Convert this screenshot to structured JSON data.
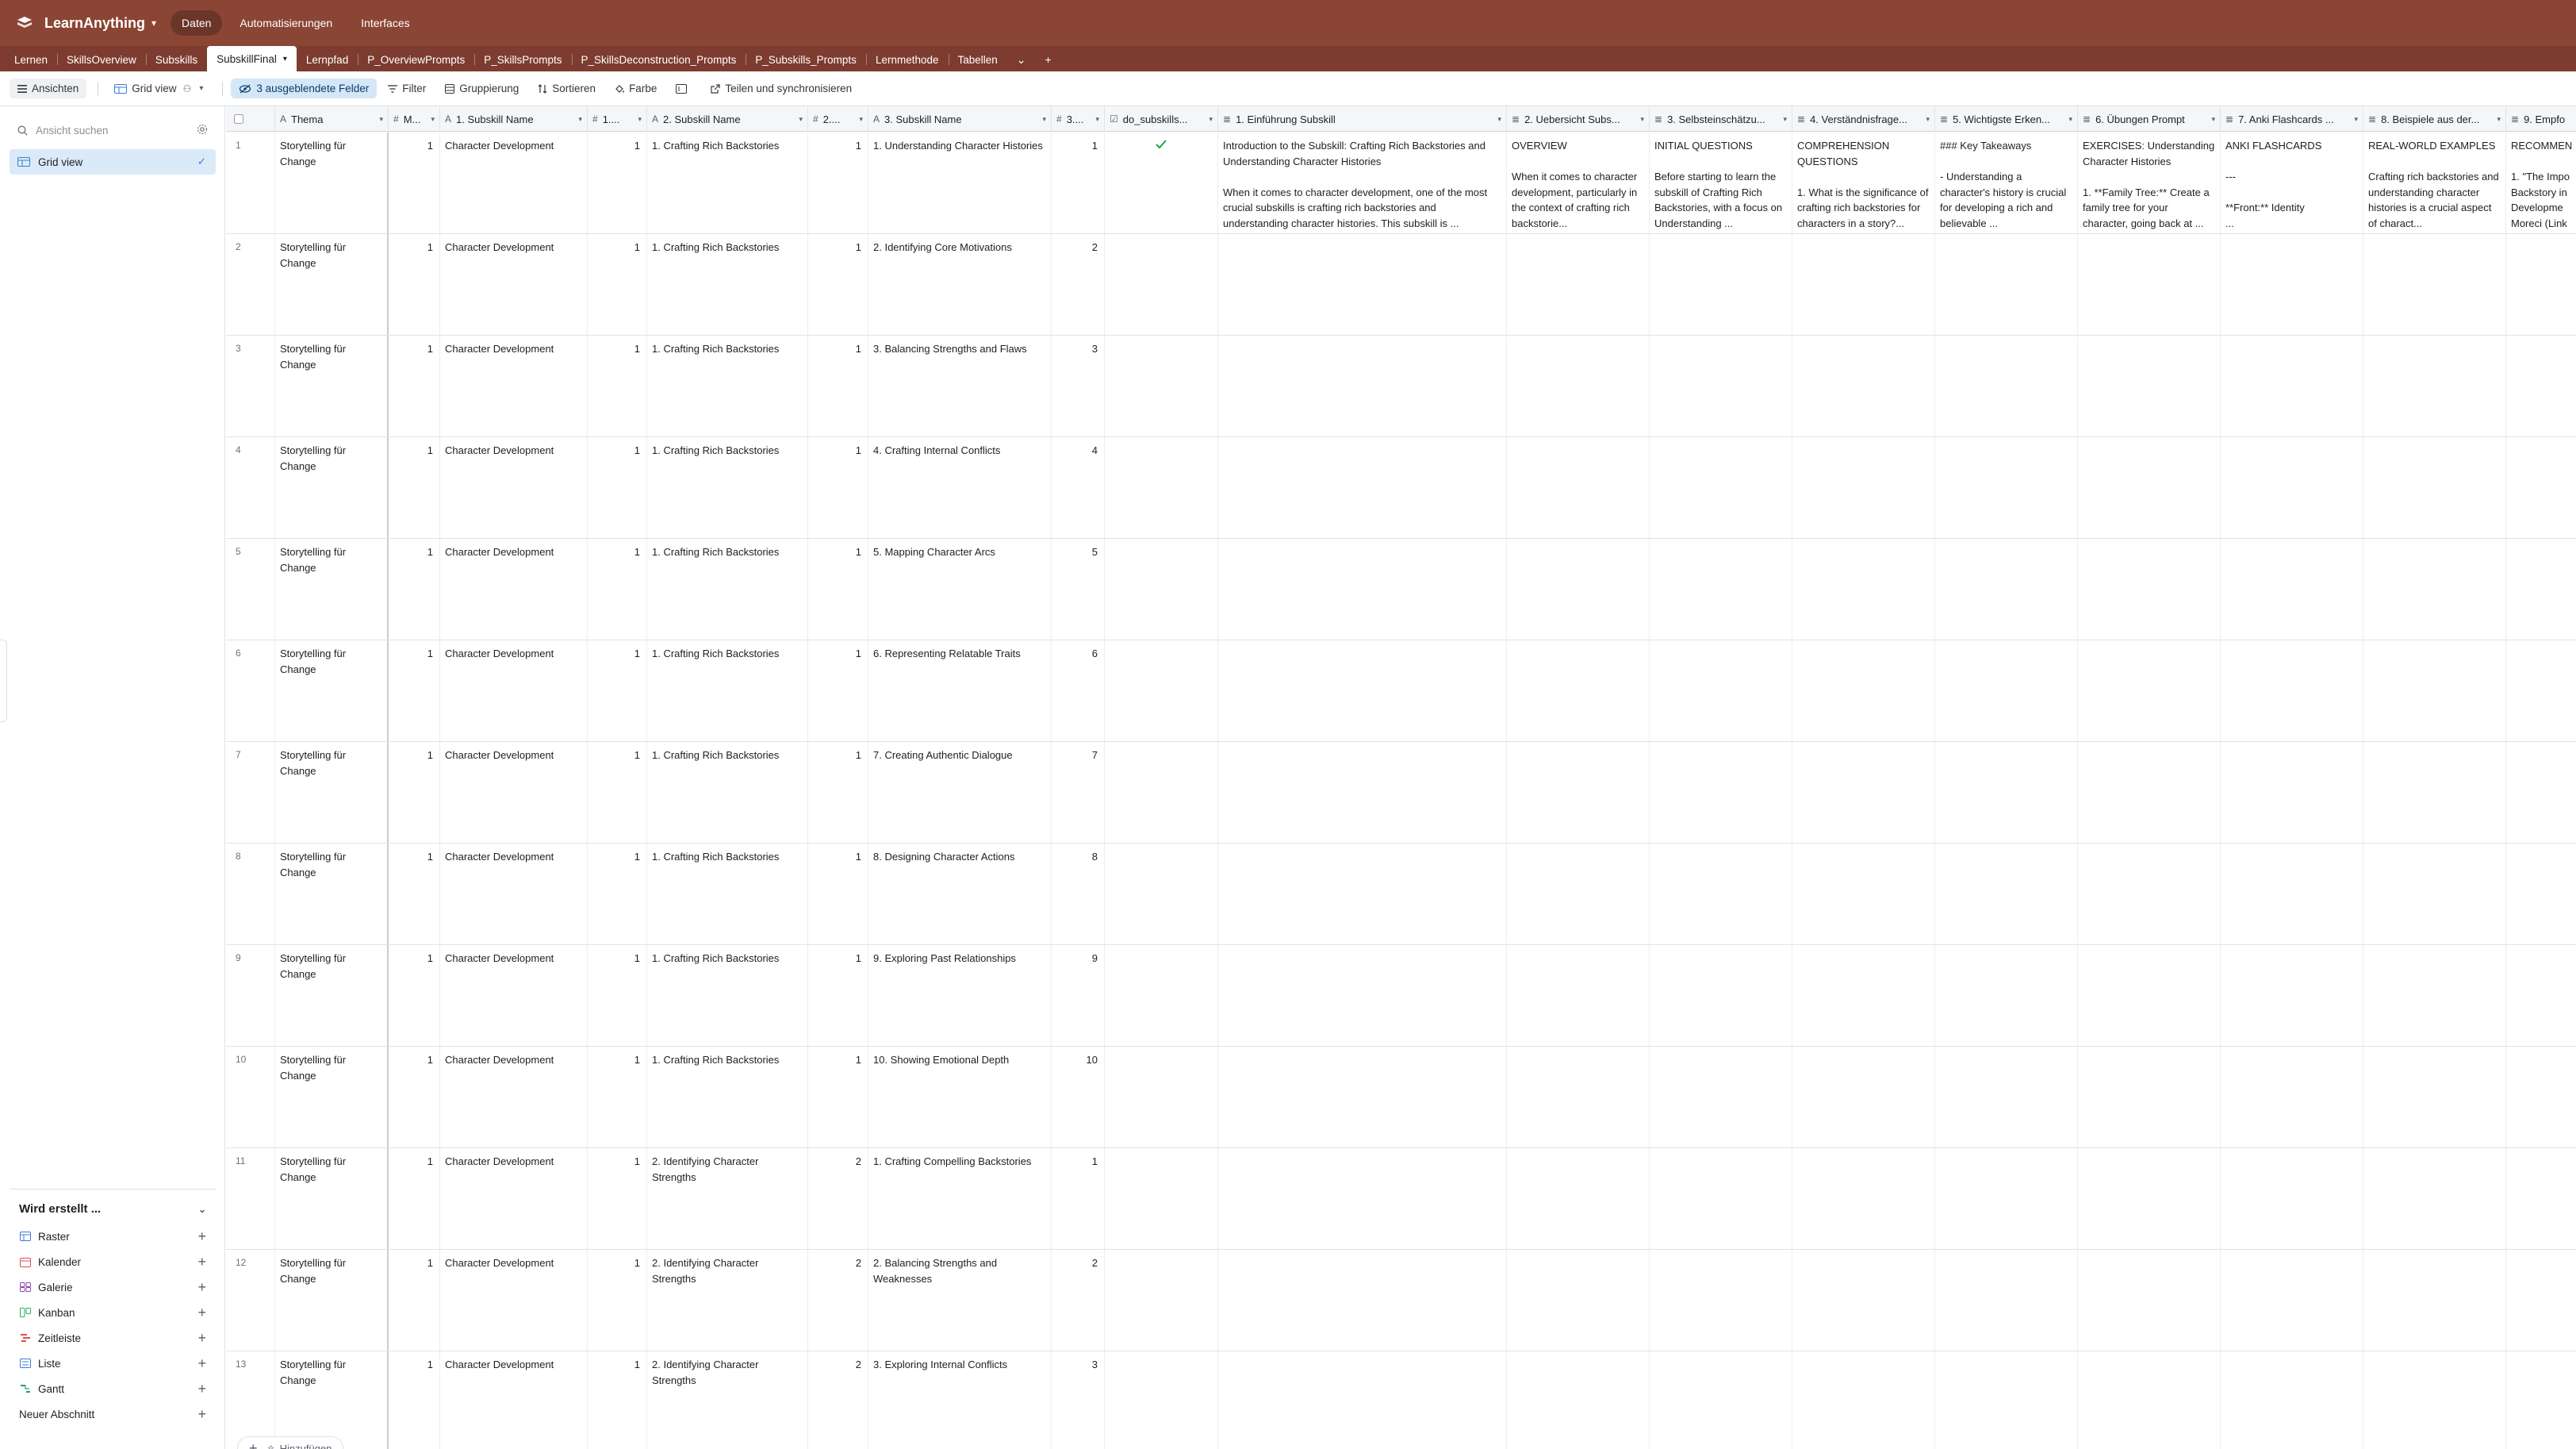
{
  "app": {
    "name": "LearnAnything",
    "top_tabs": [
      {
        "label": "Daten",
        "active": true
      },
      {
        "label": "Automatisierungen",
        "active": false
      },
      {
        "label": "Interfaces",
        "active": false
      }
    ],
    "brand_color": "#8b4535"
  },
  "tables": {
    "tabs": [
      "Lernen",
      "SkillsOverview",
      "Subskills",
      "SubskillFinal",
      "Lernpfad",
      "P_OverviewPrompts",
      "P_SkillsPrompts",
      "P_SkillsDeconstruction_Prompts",
      "P_Subskills_Prompts",
      "Lernmethode",
      "Tabellen"
    ],
    "active": "SubskillFinal"
  },
  "toolbar": {
    "views_label": "Ansichten",
    "view_name": "Grid view",
    "hidden_fields": "3 ausgeblendete Felder",
    "filter": "Filter",
    "group": "Gruppierung",
    "sort": "Sortieren",
    "color": "Farbe",
    "share": "Teilen und synchronisieren"
  },
  "sidebar": {
    "search_placeholder": "Ansicht suchen",
    "active_view": "Grid view",
    "create_heading": "Wird erstellt ...",
    "create_items": [
      {
        "label": "Raster",
        "icon": "grid-icon",
        "color": "#3b7dd8"
      },
      {
        "label": "Kalender",
        "icon": "calendar-icon",
        "color": "#d9534f"
      },
      {
        "label": "Galerie",
        "icon": "gallery-icon",
        "color": "#8e44ad"
      },
      {
        "label": "Kanban",
        "icon": "kanban-icon",
        "color": "#27ae60"
      },
      {
        "label": "Zeitleiste",
        "icon": "timeline-icon",
        "color": "#d9534f"
      },
      {
        "label": "Liste",
        "icon": "list-icon",
        "color": "#3b7dd8"
      },
      {
        "label": "Gantt",
        "icon": "gantt-icon",
        "color": "#16a085"
      }
    ],
    "new_section": "Neuer Abschnitt"
  },
  "grid": {
    "headers": [
      "Thema",
      "M...",
      "1. Subskill Name",
      "1....",
      "2. Subskill Name",
      "2....",
      "3. Subskill Name",
      "3....",
      "do_subskills...",
      "1. Einführung Subskill",
      "2. Uebersicht Subs...",
      "3. Selbsteinschätzu...",
      "4. Verständnisfrage...",
      "5. Wichtigste Erken...",
      "6. Übungen Prompt",
      "7. Anki Flashcards ...",
      "8. Beispiele aus der...",
      "9. Empfo"
    ],
    "rows": [
      {
        "n": "1",
        "thema": "Storytelling für Change",
        "m": "1",
        "s1": "Character Development",
        "n1": "1",
        "s2": "1. Crafting Rich Backstories",
        "n2": "1",
        "s3": "1. Understanding Character Histories",
        "n3": "1",
        "done": true,
        "e1": "Introduction to the Subskill: Crafting Rich Backstories and Understanding Character Histories\n\nWhen it comes to character development, one of the most crucial subskills is crafting rich backstories and understanding character histories. This subskill is ...",
        "e2": "OVERVIEW\n\nWhen it comes to character development, particularly in the context of crafting rich backstorie...",
        "e3": "INITIAL QUESTIONS\n\nBefore starting to learn the subskill of Crafting Rich Backstories, with a focus on Understanding ...",
        "e4": "COMPREHENSION QUESTIONS\n\n1. What is the significance of crafting rich backstories for characters in a story?...",
        "e5": "### Key Takeaways\n\n- Understanding a character's history is crucial for developing a rich and believable ...",
        "e6": "EXERCISES: Understanding Character Histories\n\n1. **Family Tree:** Create a family tree for your character, going back at ...",
        "e7": "ANKI FLASHCARDS\n\n---\n\n**Front:** Identity\n...",
        "e8": "REAL-WORLD EXAMPLES\n\nCrafting rich backstories and understanding character histories is a crucial aspect of charact...",
        "e9": "RECOMMEN\n\n1. \"The Impo Backstory in Developme Moreci (Link"
      },
      {
        "n": "2",
        "thema": "Storytelling für Change",
        "m": "1",
        "s1": "Character Development",
        "n1": "1",
        "s2": "1. Crafting Rich Backstories",
        "n2": "1",
        "s3": "2. Identifying Core Motivations",
        "n3": "2"
      },
      {
        "n": "3",
        "thema": "Storytelling für Change",
        "m": "1",
        "s1": "Character Development",
        "n1": "1",
        "s2": "1. Crafting Rich Backstories",
        "n2": "1",
        "s3": "3. Balancing Strengths and Flaws",
        "n3": "3"
      },
      {
        "n": "4",
        "thema": "Storytelling für Change",
        "m": "1",
        "s1": "Character Development",
        "n1": "1",
        "s2": "1. Crafting Rich Backstories",
        "n2": "1",
        "s3": "4. Crafting Internal Conflicts",
        "n3": "4"
      },
      {
        "n": "5",
        "thema": "Storytelling für Change",
        "m": "1",
        "s1": "Character Development",
        "n1": "1",
        "s2": "1. Crafting Rich Backstories",
        "n2": "1",
        "s3": "5. Mapping Character Arcs",
        "n3": "5"
      },
      {
        "n": "6",
        "thema": "Storytelling für Change",
        "m": "1",
        "s1": "Character Development",
        "n1": "1",
        "s2": "1. Crafting Rich Backstories",
        "n2": "1",
        "s3": "6. Representing Relatable Traits",
        "n3": "6"
      },
      {
        "n": "7",
        "thema": "Storytelling für Change",
        "m": "1",
        "s1": "Character Development",
        "n1": "1",
        "s2": "1. Crafting Rich Backstories",
        "n2": "1",
        "s3": "7. Creating Authentic Dialogue",
        "n3": "7"
      },
      {
        "n": "8",
        "thema": "Storytelling für Change",
        "m": "1",
        "s1": "Character Development",
        "n1": "1",
        "s2": "1. Crafting Rich Backstories",
        "n2": "1",
        "s3": "8. Designing Character Actions",
        "n3": "8"
      },
      {
        "n": "9",
        "thema": "Storytelling für Change",
        "m": "1",
        "s1": "Character Development",
        "n1": "1",
        "s2": "1. Crafting Rich Backstories",
        "n2": "1",
        "s3": "9. Exploring Past Relationships",
        "n3": "9"
      },
      {
        "n": "10",
        "thema": "Storytelling für Change",
        "m": "1",
        "s1": "Character Development",
        "n1": "1",
        "s2": "1. Crafting Rich Backstories",
        "n2": "1",
        "s3": "10. Showing Emotional Depth",
        "n3": "10"
      },
      {
        "n": "11",
        "thema": "Storytelling für Change",
        "m": "1",
        "s1": "Character Development",
        "n1": "1",
        "s2": "2. Identifying Character Strengths",
        "n2": "2",
        "s3": "1. Crafting Compelling Backstories",
        "n3": "1"
      },
      {
        "n": "12",
        "thema": "Storytelling für Change",
        "m": "1",
        "s1": "Character Development",
        "n1": "1",
        "s2": "2. Identifying Character Strengths",
        "n2": "2",
        "s3": "2. Balancing Strengths and Weaknesses",
        "n3": "2"
      },
      {
        "n": "13",
        "thema": "Storytelling für Change",
        "m": "1",
        "s1": "Character Development",
        "n1": "1",
        "s2": "2. Identifying Character Strengths",
        "n2": "2",
        "s3": "3. Exploring Internal Conflicts",
        "n3": "3"
      }
    ],
    "add_label": "Hinzufügen"
  }
}
